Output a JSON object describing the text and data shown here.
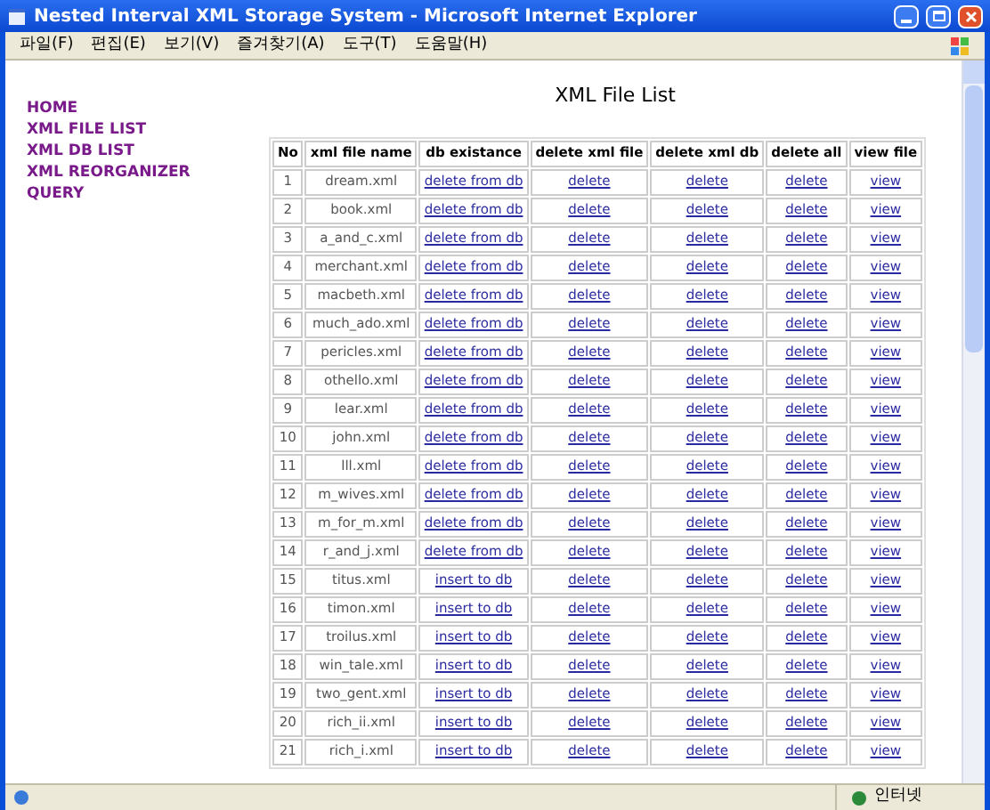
{
  "window": {
    "title": "Nested Interval XML Storage System - Microsoft Internet Explorer"
  },
  "menu": [
    "파일(F)",
    "편집(E)",
    "보기(V)",
    "즐겨찾기(A)",
    "도구(T)",
    "도움말(H)"
  ],
  "sidebar": {
    "items": [
      "HOME",
      "XML FILE LIST",
      "XML DB LIST",
      "XML REORGANIZER",
      "QUERY"
    ]
  },
  "page_title": "XML File List",
  "table": {
    "columns": [
      "No",
      "xml file name",
      "db existance",
      "delete xml file",
      "delete xml db",
      "delete all",
      "view file"
    ],
    "rows": [
      {
        "no": "1",
        "file": "dream.xml",
        "db": "delete from db",
        "del_file": "delete",
        "del_db": "delete",
        "del_all": "delete",
        "view": "view"
      },
      {
        "no": "2",
        "file": "book.xml",
        "db": "delete from db",
        "del_file": "delete",
        "del_db": "delete",
        "del_all": "delete",
        "view": "view"
      },
      {
        "no": "3",
        "file": "a_and_c.xml",
        "db": "delete from db",
        "del_file": "delete",
        "del_db": "delete",
        "del_all": "delete",
        "view": "view"
      },
      {
        "no": "4",
        "file": "merchant.xml",
        "db": "delete from db",
        "del_file": "delete",
        "del_db": "delete",
        "del_all": "delete",
        "view": "view"
      },
      {
        "no": "5",
        "file": "macbeth.xml",
        "db": "delete from db",
        "del_file": "delete",
        "del_db": "delete",
        "del_all": "delete",
        "view": "view"
      },
      {
        "no": "6",
        "file": "much_ado.xml",
        "db": "delete from db",
        "del_file": "delete",
        "del_db": "delete",
        "del_all": "delete",
        "view": "view"
      },
      {
        "no": "7",
        "file": "pericles.xml",
        "db": "delete from db",
        "del_file": "delete",
        "del_db": "delete",
        "del_all": "delete",
        "view": "view"
      },
      {
        "no": "8",
        "file": "othello.xml",
        "db": "delete from db",
        "del_file": "delete",
        "del_db": "delete",
        "del_all": "delete",
        "view": "view"
      },
      {
        "no": "9",
        "file": "lear.xml",
        "db": "delete from db",
        "del_file": "delete",
        "del_db": "delete",
        "del_all": "delete",
        "view": "view"
      },
      {
        "no": "10",
        "file": "john.xml",
        "db": "delete from db",
        "del_file": "delete",
        "del_db": "delete",
        "del_all": "delete",
        "view": "view"
      },
      {
        "no": "11",
        "file": "lll.xml",
        "db": "delete from db",
        "del_file": "delete",
        "del_db": "delete",
        "del_all": "delete",
        "view": "view"
      },
      {
        "no": "12",
        "file": "m_wives.xml",
        "db": "delete from db",
        "del_file": "delete",
        "del_db": "delete",
        "del_all": "delete",
        "view": "view"
      },
      {
        "no": "13",
        "file": "m_for_m.xml",
        "db": "delete from db",
        "del_file": "delete",
        "del_db": "delete",
        "del_all": "delete",
        "view": "view"
      },
      {
        "no": "14",
        "file": "r_and_j.xml",
        "db": "delete from db",
        "del_file": "delete",
        "del_db": "delete",
        "del_all": "delete",
        "view": "view"
      },
      {
        "no": "15",
        "file": "titus.xml",
        "db": "insert to db",
        "del_file": "delete",
        "del_db": "delete",
        "del_all": "delete",
        "view": "view"
      },
      {
        "no": "16",
        "file": "timon.xml",
        "db": "insert to db",
        "del_file": "delete",
        "del_db": "delete",
        "del_all": "delete",
        "view": "view"
      },
      {
        "no": "17",
        "file": "troilus.xml",
        "db": "insert to db",
        "del_file": "delete",
        "del_db": "delete",
        "del_all": "delete",
        "view": "view"
      },
      {
        "no": "18",
        "file": "win_tale.xml",
        "db": "insert to db",
        "del_file": "delete",
        "del_db": "delete",
        "del_all": "delete",
        "view": "view"
      },
      {
        "no": "19",
        "file": "two_gent.xml",
        "db": "insert to db",
        "del_file": "delete",
        "del_db": "delete",
        "del_all": "delete",
        "view": "view"
      },
      {
        "no": "20",
        "file": "rich_ii.xml",
        "db": "insert to db",
        "del_file": "delete",
        "del_db": "delete",
        "del_all": "delete",
        "view": "view"
      },
      {
        "no": "21",
        "file": "rich_i.xml",
        "db": "insert to db",
        "del_file": "delete",
        "del_db": "delete",
        "del_all": "delete",
        "view": "view"
      }
    ]
  },
  "status_bar": {
    "zone": "인터넷"
  }
}
